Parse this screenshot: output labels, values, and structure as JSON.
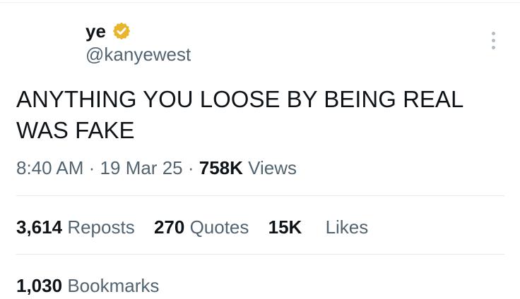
{
  "tweet": {
    "author": {
      "display_name": "ye",
      "handle": "@kanyewest",
      "verified_icon": "verified-badge-icon",
      "verified_color": "#e8b62c"
    },
    "more_icon": "more-vertical-icon",
    "text": "ANYTHING YOU LOOSE BY BEING REAL\nWAS FAKE",
    "meta": {
      "time": "8:40 AM",
      "separator": "·",
      "date": "19 Mar 25",
      "views_count": "758K",
      "views_label": "Views"
    },
    "stats": {
      "reposts_count": "3,614",
      "reposts_label": "Reposts",
      "quotes_count": "270",
      "quotes_label": "Quotes",
      "likes_count": "15K",
      "likes_label": "Likes",
      "bookmarks_count": "1,030",
      "bookmarks_label": "Bookmarks"
    }
  },
  "colors": {
    "text_primary": "#0f1419",
    "text_secondary": "#536471",
    "divider": "#e6eaec"
  }
}
